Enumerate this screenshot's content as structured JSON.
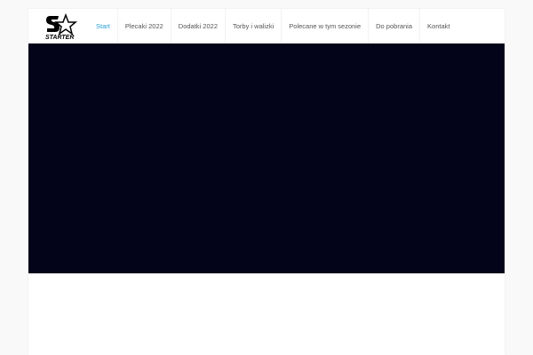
{
  "logo": {
    "text": "STARTER"
  },
  "nav": [
    {
      "label": "Start",
      "active": true
    },
    {
      "label": "Plecaki 2022"
    },
    {
      "label": "Dodatki 2022"
    },
    {
      "label": "Torby i walizki"
    },
    {
      "label": "Polecane w tym sezonie"
    },
    {
      "label": "Do pobrania"
    },
    {
      "label": "Kontakt"
    }
  ],
  "colors": {
    "accent": "#2a9fd6",
    "hero": "#03031a"
  }
}
